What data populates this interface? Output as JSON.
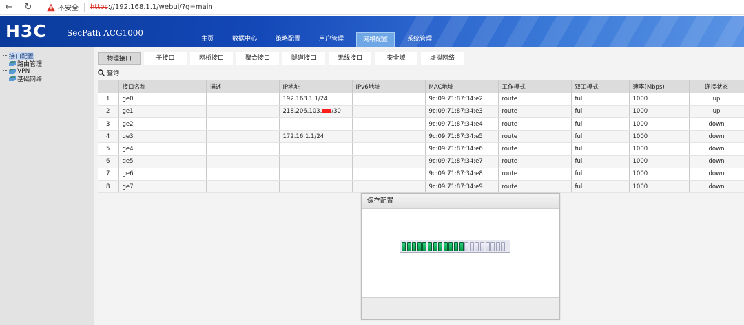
{
  "browser": {
    "back_icon": "back-arrow-icon",
    "refresh_icon": "refresh-icon",
    "insecure_label": "不安全",
    "url_scheme": "https",
    "url_rest": "://192.168.1.1/webui/?g=main"
  },
  "header": {
    "logo": "H3C",
    "product": "SecPath ACG1000",
    "tabs": [
      {
        "label": "主页"
      },
      {
        "label": "数据中心"
      },
      {
        "label": "策略配置"
      },
      {
        "label": "用户管理"
      },
      {
        "label": "网络配置",
        "active": true
      },
      {
        "label": "系统管理"
      }
    ]
  },
  "sidebar": {
    "items": [
      {
        "label": "接口配置",
        "active": true
      },
      {
        "label": "路由管理"
      },
      {
        "label": "VPN"
      },
      {
        "label": "基础网络"
      }
    ]
  },
  "subtabs": [
    {
      "label": "物理接口",
      "active": true
    },
    {
      "label": "子接口"
    },
    {
      "label": "网桥接口"
    },
    {
      "label": "聚合接口"
    },
    {
      "label": "隧道接口"
    },
    {
      "label": "无线接口"
    },
    {
      "label": "安全域"
    },
    {
      "label": "虚拟网络"
    }
  ],
  "query": {
    "label": "查询",
    "icon": "search-icon"
  },
  "table": {
    "columns": [
      "",
      "接口名称",
      "描述",
      "IP地址",
      "IPv6地址",
      "MAC地址",
      "工作模式",
      "双工模式",
      "速率(Mbps)",
      "连接状态"
    ],
    "rows": [
      [
        "1",
        "ge0",
        "",
        "192.168.1.1/24",
        "",
        "9c:09:71:87:34:e2",
        "route",
        "full",
        "1000",
        "up"
      ],
      [
        "2",
        "ge1",
        "",
        "218.206.103.",
        "",
        "9c:09:71:87:34:e3",
        "route",
        "full",
        "1000",
        "up"
      ],
      [
        "3",
        "ge2",
        "",
        "",
        "",
        "9c:09:71:87:34:e4",
        "route",
        "full",
        "1000",
        "down"
      ],
      [
        "4",
        "ge3",
        "",
        "172.16.1.1/24",
        "",
        "9c:09:71:87:34:e5",
        "route",
        "full",
        "1000",
        "down"
      ],
      [
        "5",
        "ge4",
        "",
        "",
        "",
        "9c:09:71:87:34:e6",
        "route",
        "full",
        "1000",
        "down"
      ],
      [
        "6",
        "ge5",
        "",
        "",
        "",
        "9c:09:71:87:34:e7",
        "route",
        "full",
        "1000",
        "down"
      ],
      [
        "7",
        "ge6",
        "",
        "",
        "",
        "9c:09:71:87:34:e8",
        "route",
        "full",
        "1000",
        "down"
      ],
      [
        "8",
        "ge7",
        "",
        "",
        "",
        "9c:09:71:87:34:e9",
        "route",
        "full",
        "1000",
        "down"
      ]
    ],
    "ge1_ip_suffix": "/30"
  },
  "dialog": {
    "title": "保存配置",
    "progress_filled": 12,
    "progress_total": 20
  },
  "colors": {
    "header_blue": "#1448b8",
    "progress_green": "#0a9a4d",
    "redaction": "#ff1e1e"
  }
}
